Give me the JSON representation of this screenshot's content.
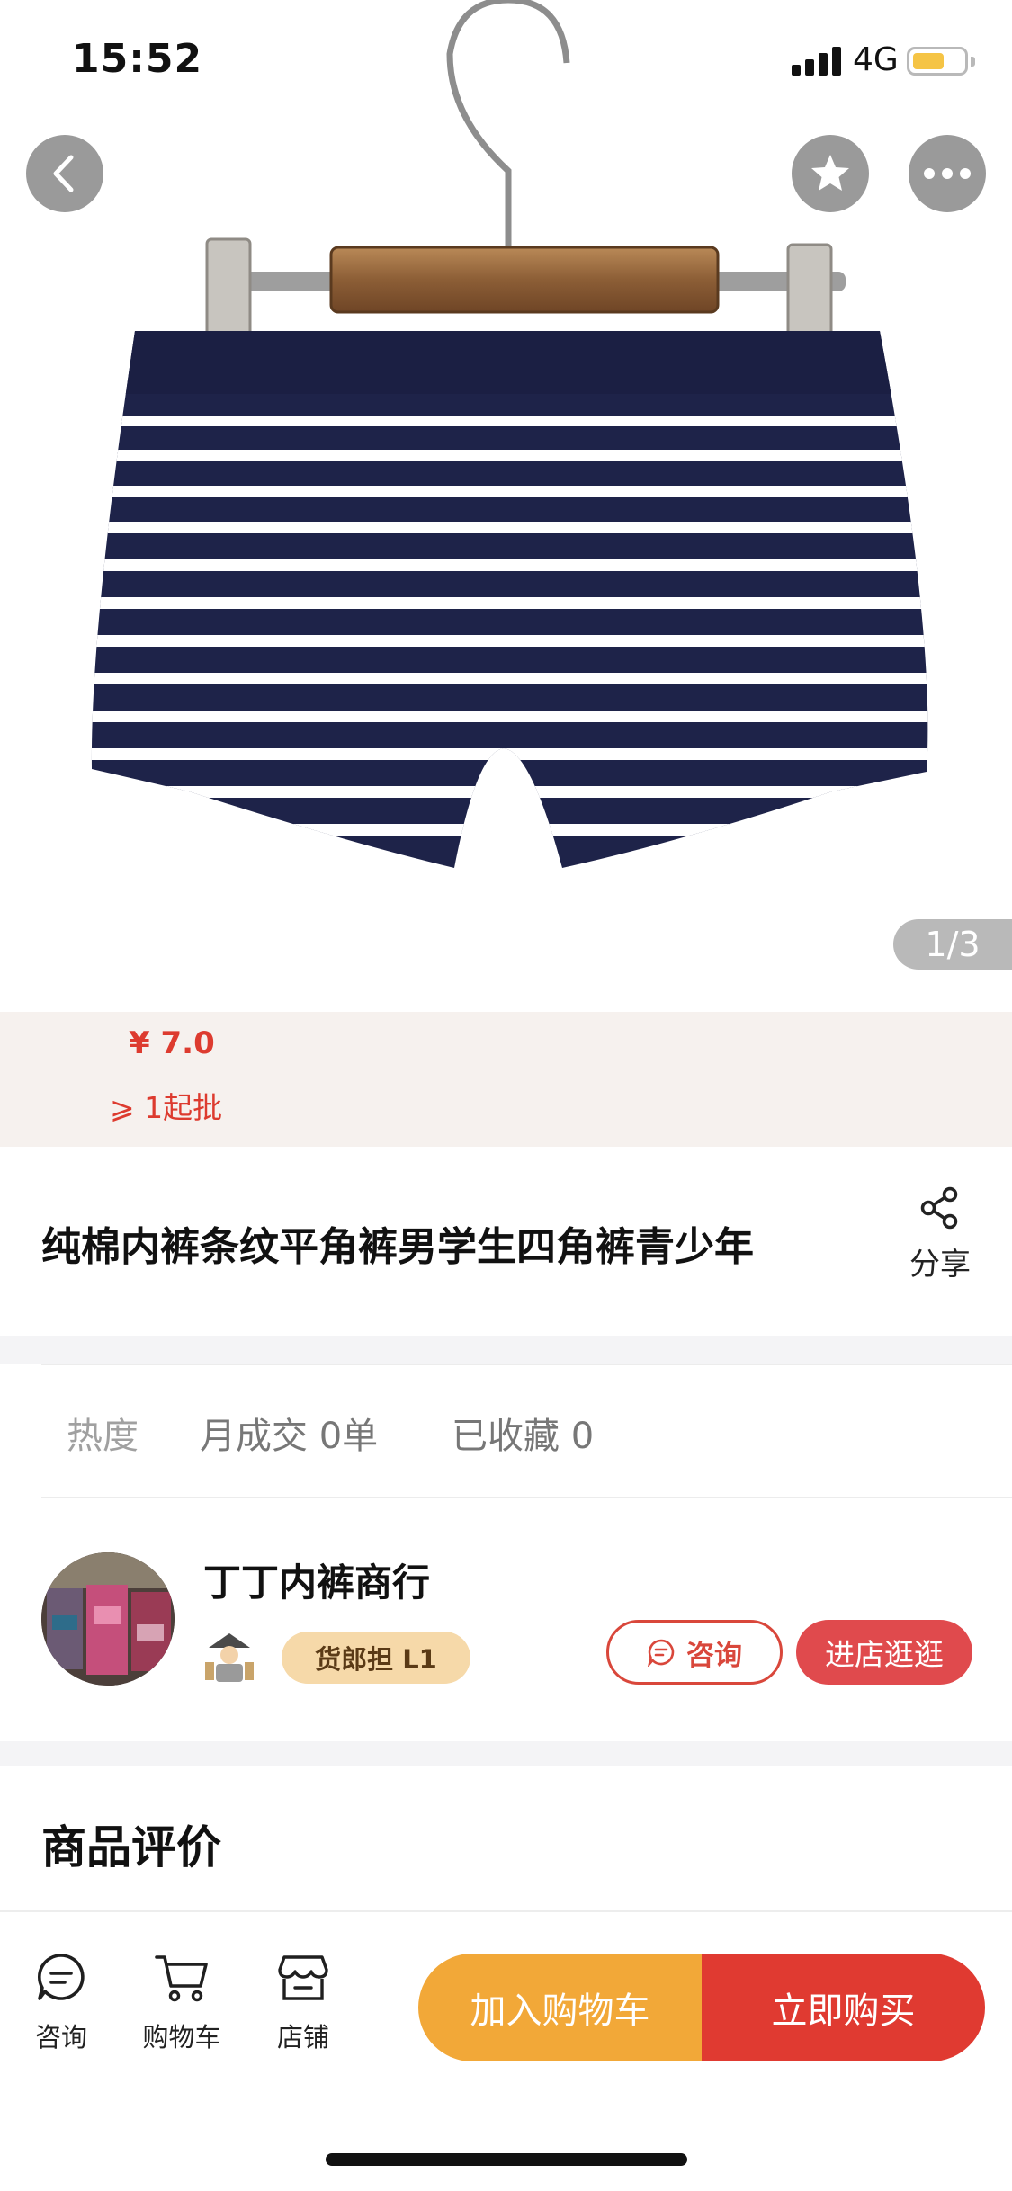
{
  "status_bar": {
    "time": "15:52",
    "network": "4G",
    "battery_level": 0.6,
    "battery_color": "#f5c445"
  },
  "gallery": {
    "pager": "1/3",
    "current_index": 1,
    "total": 3
  },
  "header": {
    "back_icon": "chevron-left-icon",
    "favorite_icon": "star-icon",
    "more_icon": "more-dots-icon"
  },
  "price": {
    "value": "¥ 7.0",
    "min_order": "⩾ 1起批",
    "color": "#dd3b2f"
  },
  "product": {
    "title": "纯棉内裤条纹平角裤男学生四角裤青少年",
    "share_label": "分享",
    "share_icon": "share-icon"
  },
  "stats": {
    "heat": "热度",
    "monthly_deals": "月成交 0单",
    "favorites": "已收藏 0"
  },
  "shop": {
    "name": "丁丁内裤商行",
    "level": "货郎担 L1",
    "consult_label": "咨询",
    "visit_label": "进店逛逛"
  },
  "reviews": {
    "title": "商品评价"
  },
  "bottom_bar": {
    "tabs": [
      {
        "label": "咨询",
        "icon": "chat-icon"
      },
      {
        "label": "购物车",
        "icon": "cart-icon"
      },
      {
        "label": "店铺",
        "icon": "store-icon"
      }
    ],
    "add_to_cart": "加入购物车",
    "buy_now": "立即购买",
    "cart_color": "#f2a838",
    "buy_color": "#e03a31"
  }
}
